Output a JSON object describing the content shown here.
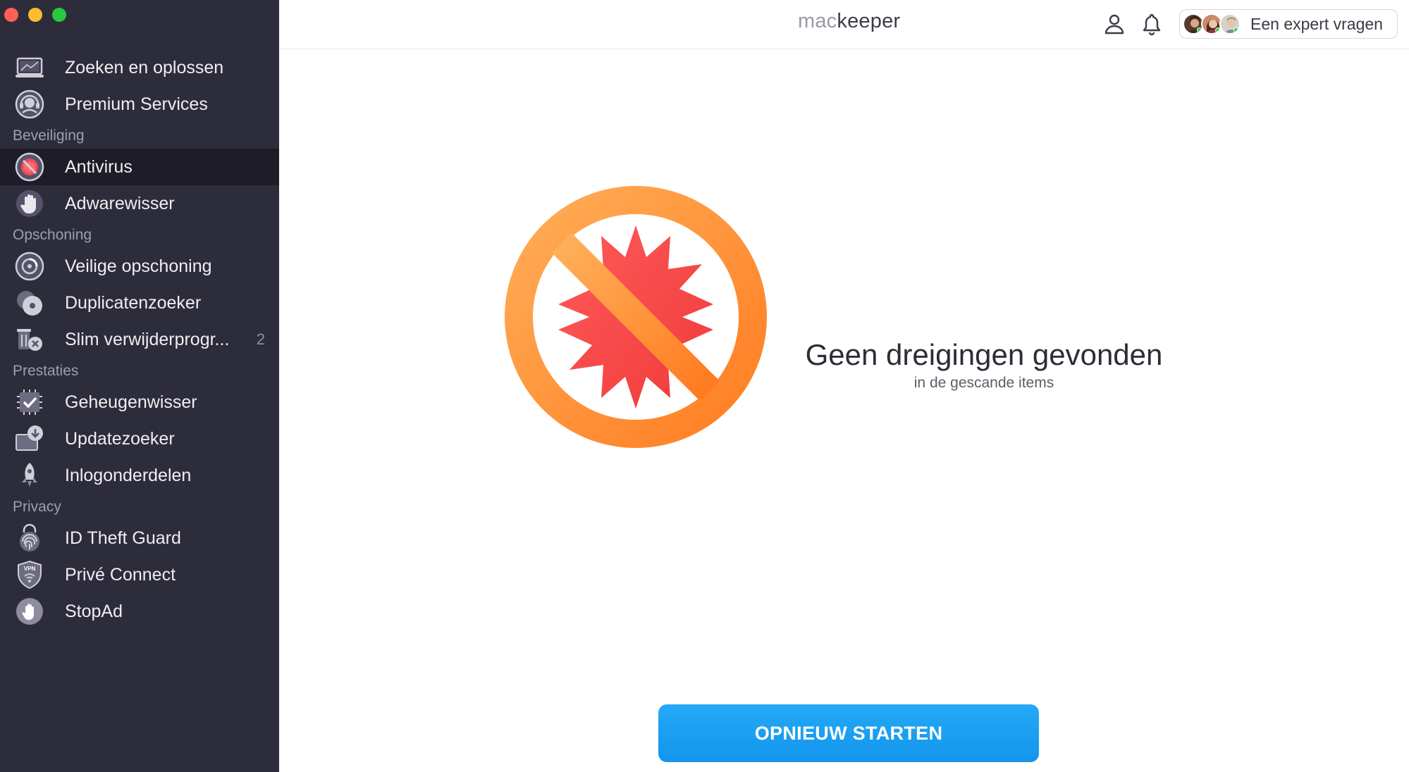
{
  "colors": {
    "sidebar_bg": "#2d2c3a",
    "sidebar_active_bg": "#1d1c27",
    "accent_blue": "#1e9ff2",
    "threat_orange": "#ff8a2a",
    "threat_red": "#ff4d4d"
  },
  "sidebar": {
    "items_top": [
      {
        "label": "Zoeken en oplossen",
        "icon": "laptop-icon"
      },
      {
        "label": "Premium Services",
        "icon": "support-agent-icon"
      }
    ],
    "sections": [
      {
        "title": "Beveiliging",
        "items": [
          {
            "label": "Antivirus",
            "icon": "antivirus-icon",
            "active": true
          },
          {
            "label": "Adwarewisser",
            "icon": "hand-stop-icon"
          }
        ]
      },
      {
        "title": "Opschoning",
        "items": [
          {
            "label": "Veilige opschoning",
            "icon": "disk-clean-icon"
          },
          {
            "label": "Duplicatenzoeker",
            "icon": "duplicates-icon"
          },
          {
            "label": "Slim verwijderprogr...",
            "icon": "uninstaller-icon",
            "badge": "2"
          }
        ]
      },
      {
        "title": "Prestaties",
        "items": [
          {
            "label": "Geheugenwisser",
            "icon": "memory-check-icon"
          },
          {
            "label": "Updatezoeker",
            "icon": "update-download-icon"
          },
          {
            "label": "Inlogonderdelen",
            "icon": "rocket-icon"
          }
        ]
      },
      {
        "title": "Privacy",
        "items": [
          {
            "label": "ID Theft Guard",
            "icon": "fingerprint-lock-icon"
          },
          {
            "label": "Privé Connect",
            "icon": "vpn-shield-icon"
          },
          {
            "label": "StopAd",
            "icon": "stopad-hand-icon"
          }
        ]
      }
    ]
  },
  "header": {
    "brand_mac": "mac",
    "brand_keeper": "keeper",
    "expert_button": "Een expert vragen"
  },
  "main": {
    "title": "Geen dreigingen gevonden",
    "subtitle": "in de gescande items",
    "restart_button": "OPNIEUW STARTEN"
  }
}
